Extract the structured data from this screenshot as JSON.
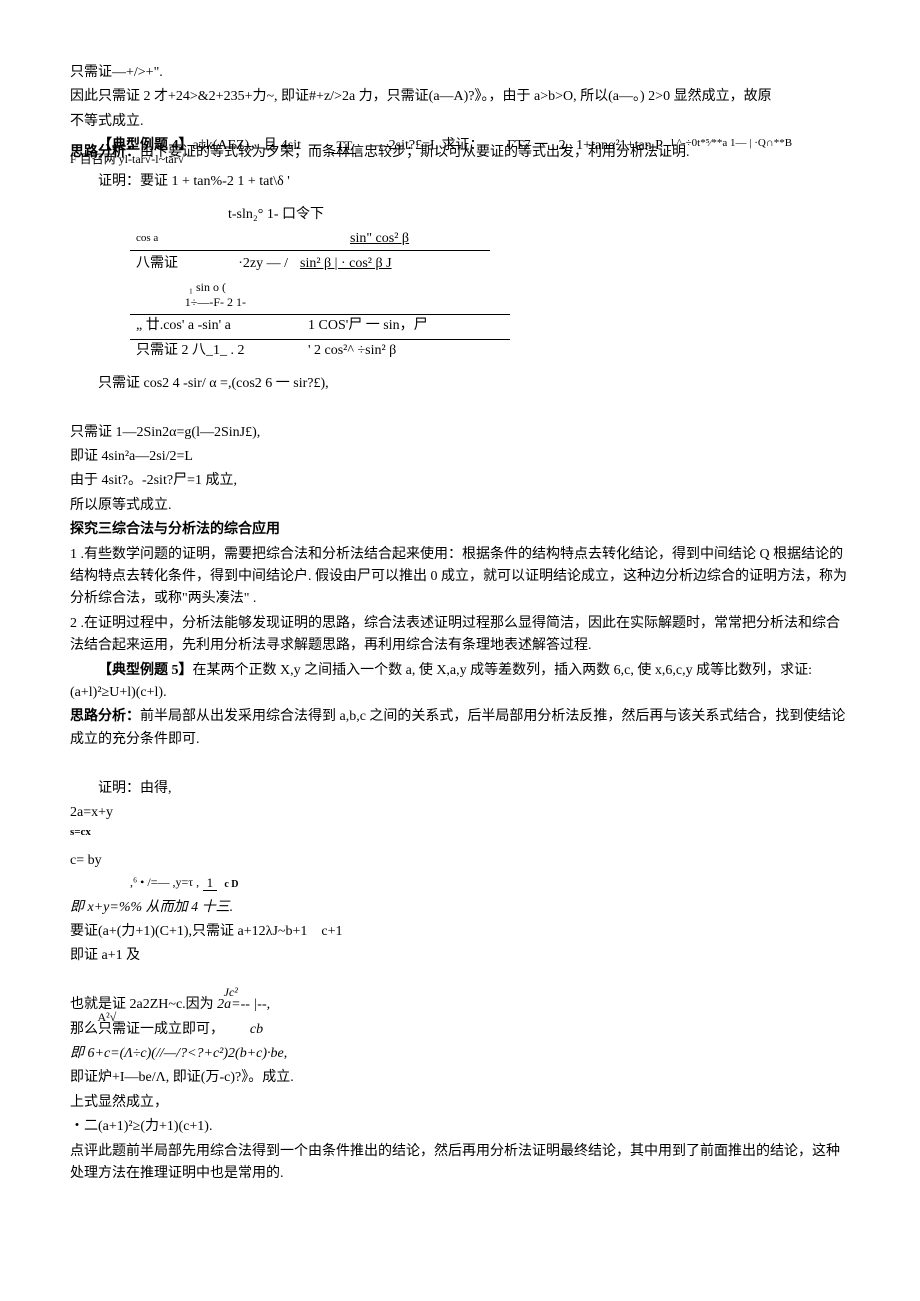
{
  "p1": "只需证—+/>+\".",
  "p2": "因此只需证 2 才+24>&2+235+力~, 即证#+z/>2a 力，只需证(a—A)?》。，由于 a>b>O, 所以(a—。) 2>0 显然成立，故原",
  "p3": "不等式成立.",
  "p4a": "【典型例题 4】",
  "p4b": "a‡k(AEZ)，且 4sit",
  "p4c": "— 2sit?£=L 求证：",
  "p4d": "l.^-÷0t*⁵⁄**a  1— | ·Q∩**B",
  "p5a": "思路分析：",
  "p5b": "由卞要证的等式较为夕荣；而条林信忠较步；斯以可从要证的等式出发，利用分析法证明.",
  "p5c": "F 百召两 yl-tar√-l~tar√",
  "p6": "证明：要证 1 + tan%-2 1 + tat\\δ '",
  "t1": "t-sln₂° 1- 口令下",
  "t2a": "cos a",
  "t2b": "sin\" cos² β",
  "t3a": "八需证",
  "t3b": "·2zy — /",
  "t3c": "sin² β | · cos² β J",
  "t4a": "₁ sin o (",
  "t4b": "1÷—-F- 2 1-",
  "t5a": "„ 廿.cos' a -sin' a",
  "t5b": "1 COS'尸 一 sin，尸",
  "t6a": "只需证 2 八_1_ . 2",
  "t6b": "' 2 cos²^ ÷sin² β",
  "p7": "只需证 cos2 4 -sir/ α =,(cos2 6 一 sir?£),",
  "p8": "只需证 1—2Sin2α=g(l—2SinJ£),",
  "p9": "即证 4sin²a—2si/2=L",
  "p10": "由于 4sit?。-2sit?尸=1 成立,",
  "p11": "所以原等式成立.",
  "h1": "探究三综合法与分析法的综合应用",
  "p12": "1    .有些数学问题的证明，需要把综合法和分析法结合起来使用：根据条件的结构特点去转化结论，得到中间结论 Q 根据结论的结构特点去转化条件，得到中间结论户. 假设由尸可以推出 0 成立，就可以证明结论成立，这种边分析边综合的证明方法，称为分析综合法，或称\"两头凑法\" .",
  "p13": "2    .在证明过程中，分析法能够发现证明的思路，综合法表述证明过程那么显得简洁，因此在实际解题时，常常把分析法和综合法结合起来运用，先利用分析法寻求解题思路，再利用综合法有条理地表述解答过程.",
  "p14a": "【典型例题 5】",
  "p14b": "在某两个正数 X,y 之间插入一个数 a, 使 X,a,y 成等差数列，插入两数 6,c, 使 x,6,c,y 成等比数列，求证: (a+l)²≥U+l)(c+l).",
  "p15a": "思路分析：",
  "p15b": "前半局部从出发采用综合法得到 a,b,c 之间的关系式，后半局部用分析法反推，然后再与该关系式结合，找到使结论成立的充分条件即可.",
  "sys1": "2a=x+y",
  "sys2": "s=cx",
  "sys3": "c= by",
  "p16a": "证明：由得,",
  "p16b": ",⁶ • /=— ,y=τ ,",
  "p16c": "1",
  "p16d": "c D",
  "p17": "即 x+y=%% 从而加 4 十三.",
  "p18": "要证(a+(力+1)(C+1),只需证 a+12λJ~b+1　c+1",
  "p19": "即证 a+1 及",
  "p20a": "也就是证 2a2ZH~c.因为",
  "p20b": " 2a=-- |--,",
  "p20c": "Jc²",
  "p21a": "那么只需证一成立即可，",
  "p21b": "A²√",
  "p21c": "cb",
  "p22": "即 6+c=(Λ÷c)(//—/?<?+c²)2(b+c)·be,",
  "p23": "即证炉+I—be/Λ, 即证(万-c)?》。成立.",
  "p24": "上式显然成立，",
  "p25": "・二(a+1)²≥(力+1)(c+1).",
  "p26": "点评此题前半局部先用综合法得到一个由条件推出的结论，然后再用分析法证明最终结论，其中用到了前面推出的结论，这种处理方法在推理证明中也是常用的."
}
